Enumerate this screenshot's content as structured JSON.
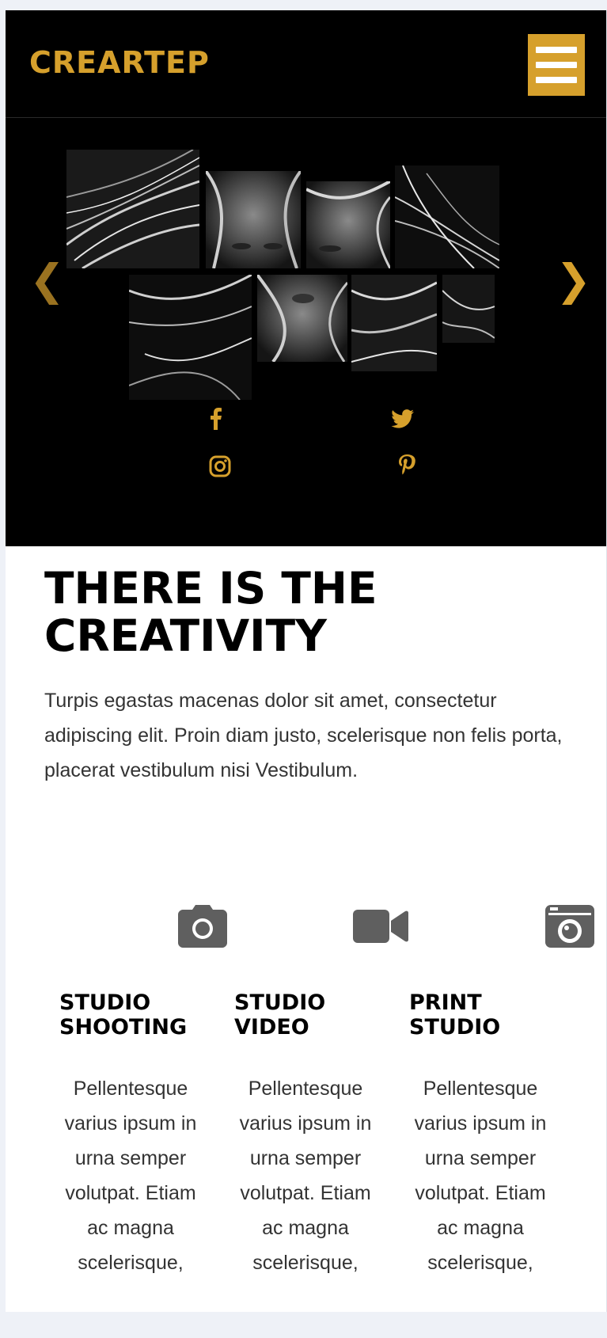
{
  "header": {
    "logo": "CREARTEP",
    "menu_icon": "hamburger-menu-icon",
    "accent_color": "#d6a02c"
  },
  "hero": {
    "prev_arrow": "❮",
    "next_arrow": "❯",
    "image_description_icon": "photo-mosaic",
    "socials": [
      {
        "name": "facebook",
        "icon": "facebook-icon"
      },
      {
        "name": "twitter",
        "icon": "twitter-icon"
      },
      {
        "name": "instagram",
        "icon": "instagram-icon"
      },
      {
        "name": "pinterest",
        "icon": "pinterest-icon"
      }
    ]
  },
  "content": {
    "headline": "THERE IS THE CREATIVITY",
    "intro": "Turpis egastas macenas dolor sit amet, consectetur adipiscing elit. Proin diam justo, scelerisque non felis porta, placerat vestibulum nisi Vestibulum."
  },
  "services": [
    {
      "icon": "camera-icon",
      "title": "STUDIO SHOOTING",
      "text": "Pellentesque varius ipsum in urna semper volutpat. Etiam ac magna scelerisque,"
    },
    {
      "icon": "video-camera-icon",
      "title": "STUDIO VIDEO",
      "text": "Pellentesque varius ipsum in urna semper volutpat. Etiam ac magna scelerisque,"
    },
    {
      "icon": "print-camera-icon",
      "title": "PRINT STUDIO",
      "text": "Pellentesque varius ipsum in urna semper volutpat. Etiam ac magna scelerisque,"
    }
  ]
}
